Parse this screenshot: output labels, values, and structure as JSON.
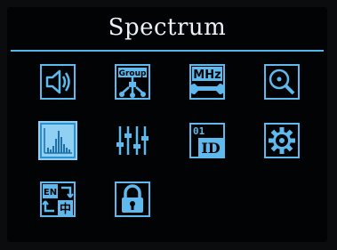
{
  "header": {
    "title": "Spectrum"
  },
  "menu": {
    "selected": "spectrum",
    "items": [
      {
        "id": "volume",
        "icon": "speaker-icon"
      },
      {
        "id": "group",
        "icon": "group-network-icon",
        "text": "Group"
      },
      {
        "id": "frequency",
        "icon": "mhz-wrench-icon",
        "text": "MHz"
      },
      {
        "id": "scan",
        "icon": "scan-magnifier-icon"
      },
      {
        "id": "spectrum",
        "icon": "spectrum-bars-icon"
      },
      {
        "id": "equalizer",
        "icon": "sliders-icon"
      },
      {
        "id": "channel-id",
        "icon": "channel-id-icon",
        "text": "01",
        "text2": "ID"
      },
      {
        "id": "settings",
        "icon": "gear-icon"
      },
      {
        "id": "language",
        "icon": "language-icon",
        "text": "EN",
        "text2": "中"
      },
      {
        "id": "lock",
        "icon": "padlock-icon"
      }
    ]
  },
  "colors": {
    "accent": "#56b6ea",
    "icon_fill": "#5fb9ec",
    "selected_bg": "#8fd0f3",
    "background": "#020305",
    "title_text": "#ecf2fa"
  }
}
